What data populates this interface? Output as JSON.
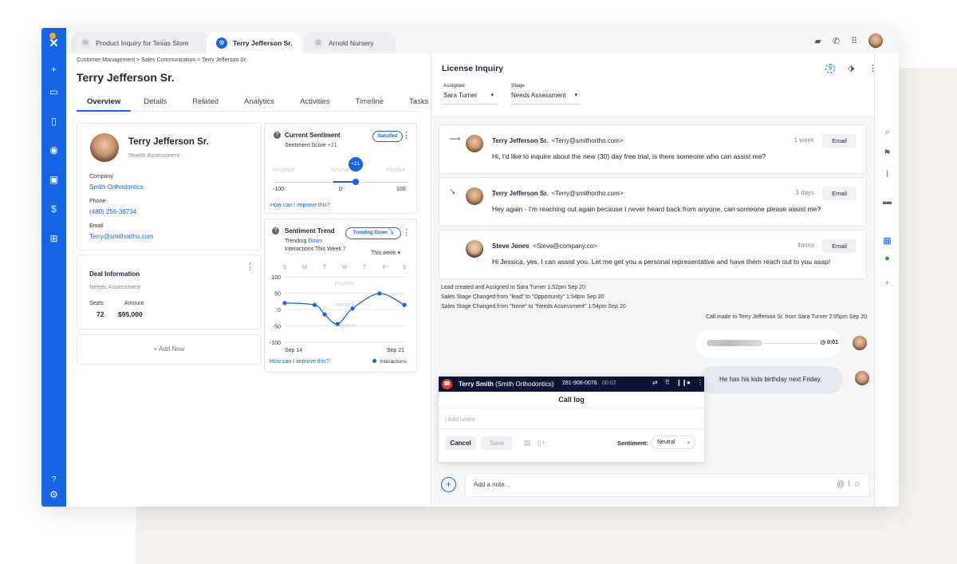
{
  "tabs": [
    {
      "label": "Product Inquiry for Texas Store",
      "icon": "document-icon"
    },
    {
      "label": "Terry Jefferson Sr.",
      "icon": "target-icon",
      "active": true
    },
    {
      "label": "Arnold Nursery",
      "icon": "building-icon"
    }
  ],
  "breadcrumb": "Customer Management  > Sales Communication > Terry Jefferson Sr.",
  "page_title": "Terry Jefferson Sr.",
  "nav_tabs": [
    "Overview",
    "Details",
    "Related",
    "Analytics",
    "Activities",
    "Timeline",
    "Tasks"
  ],
  "contact": {
    "name": "Terry Jefferson Sr.",
    "status": "Needs Assessment",
    "company_label": "Company",
    "company": "Smith Orthodontics",
    "phone_label": "Phone",
    "phone": "(480) 256-36734",
    "email_label": "Email",
    "email": "Terry@smithortho.com"
  },
  "deal": {
    "title": "Deal Information",
    "status": "Needs Assessment",
    "seats_label": "Seats",
    "seats": "72",
    "amount_label": "Amount",
    "amount": "$95,000"
  },
  "add_new": "+ Add New",
  "sentiment": {
    "title": "Current Sentiment",
    "badge": "Satisfied",
    "score_label": "Sentiment Score",
    "score": "+21",
    "score_value": 21,
    "labels": [
      "Negative",
      "Neutral",
      "Positive"
    ],
    "ticks": [
      "-100",
      "0",
      "100"
    ],
    "link": "How can I improve this?"
  },
  "trend": {
    "title": "Sentiment Trend",
    "badge": "Trending Down",
    "trending_label": "Trending",
    "trending": "Down",
    "interactions_label": "Interactions This Week",
    "interactions": "7",
    "period": "This week",
    "link": "How can I improve this?"
  },
  "chart_data": {
    "type": "line",
    "days": [
      "S",
      "M",
      "T",
      "W",
      "T",
      "F",
      "S"
    ],
    "x": [
      0,
      1.5,
      2,
      2.65,
      3.4,
      4.75,
      6
    ],
    "y": [
      20,
      14,
      -15,
      -44,
      3,
      49,
      14
    ],
    "ylim": [
      -100,
      100
    ],
    "yticks": [
      "100",
      "50",
      "0",
      "-50",
      "-100"
    ],
    "bands": [
      "Positive",
      "Neutral",
      "Negative"
    ],
    "xlabels": [
      "Sep 14",
      "Sep 21"
    ],
    "legend": "Interactions",
    "color": "#1565e6"
  },
  "right": {
    "title": "License Inquiry",
    "assignee_label": "Assignee",
    "assignee": "Sara Turner",
    "stage_label": "Stage",
    "stage": "Needs Assessment"
  },
  "messages": [
    {
      "name": "Terry Jefferson Sr.",
      "email": "<Terry@smithortho.com>",
      "time": "1 week",
      "text": "Hi, I'd like to inquire about the new (30) day free trial, is there someone who can assist me?",
      "button": "Email"
    },
    {
      "name": "Terry Jefferson Sr.",
      "email": "<Terry@smithortho.com>",
      "time": "3 days",
      "text": "Hey again - I'm reaching out again because I never heard back from anyone, can someone please assist me?",
      "button": "Email"
    },
    {
      "name": "Steve Jones",
      "email": "<Steve@company.co>",
      "time": "4mins",
      "text": "Hi Jessica, yes, I can assist you.  Let me get you a personal representative and have them reach out to you asap!",
      "button": "Email"
    }
  ],
  "logs": [
    "Lead created and Assigned to Sara Turner 1:52pm Sep 20",
    "Sales Stage Changed from \"lead\" to \"Opportunity\" 1:54pm Sep 20",
    "Sales Stage Changed from \"None\" to \"Needs Assessment\" 1:54pm Sep 20"
  ],
  "call_note": "Call made to Terry Jefferson Sr. from Sara Turner 2:05pm Sep 20",
  "audio_duration": "0:01",
  "bubble": "He has his kids birthday next Friday.",
  "call": {
    "name": "Terry Smith",
    "company": "(Smith Orthodontics)",
    "number": "281-908-0076",
    "timer": "00:02",
    "title": "Call log",
    "placeholder": "Add notes",
    "cancel": "Cancel",
    "save": "Save",
    "sentiment_label": "Sentiment:",
    "sentiment": "Neutral"
  },
  "note_placeholder": "Add a note..."
}
